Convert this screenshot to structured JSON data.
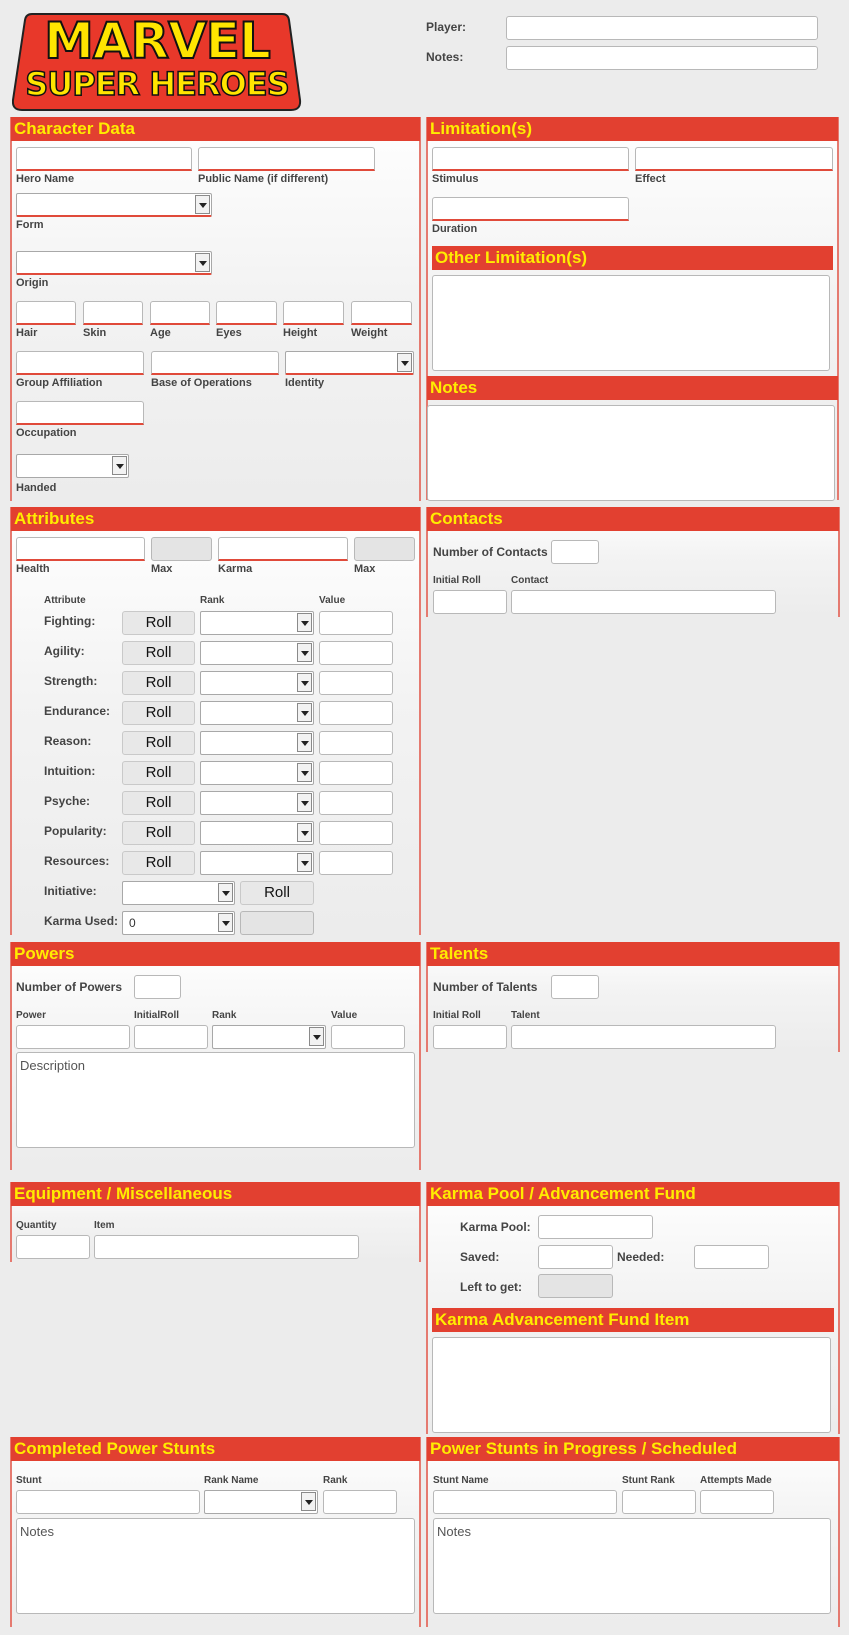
{
  "logo": {
    "line1": "MARVEL",
    "line2": "SUPER HEROES"
  },
  "header": {
    "player_label": "Player:",
    "notes_label": "Notes:"
  },
  "character_data": {
    "title": "Character Data",
    "hero_name": "Hero Name",
    "public_name": "Public Name (if different)",
    "form": "Form",
    "origin": "Origin",
    "hair": "Hair",
    "skin": "Skin",
    "age": "Age",
    "eyes": "Eyes",
    "height": "Height",
    "weight": "Weight",
    "group_affiliation": "Group Affiliation",
    "base_of_operations": "Base of Operations",
    "identity": "Identity",
    "occupation": "Occupation",
    "handed": "Handed"
  },
  "limitations": {
    "title": "Limitation(s)",
    "stimulus": "Stimulus",
    "effect": "Effect",
    "duration": "Duration",
    "other_title": "Other Limitation(s)"
  },
  "notes": {
    "title": "Notes"
  },
  "attributes": {
    "title": "Attributes",
    "health": "Health",
    "max": "Max",
    "karma": "Karma",
    "col_attribute": "Attribute",
    "col_rank": "Rank",
    "col_value": "Value",
    "roll_label": "Roll",
    "rows": [
      {
        "label": "Fighting:"
      },
      {
        "label": "Agility:"
      },
      {
        "label": "Strength:"
      },
      {
        "label": "Endurance:"
      },
      {
        "label": "Reason:"
      },
      {
        "label": "Intuition:"
      },
      {
        "label": "Psyche:"
      },
      {
        "label": "Popularity:"
      },
      {
        "label": "Resources:"
      }
    ],
    "initiative": "Initiative:",
    "karma_used": "Karma Used:",
    "karma_used_value": "0"
  },
  "contacts": {
    "title": "Contacts",
    "number_label": "Number of Contacts",
    "initial_roll": "Initial Roll",
    "contact": "Contact"
  },
  "powers": {
    "title": "Powers",
    "number_label": "Number of Powers",
    "power": "Power",
    "initial_roll": "InitialRoll",
    "rank": "Rank",
    "value": "Value",
    "description_placeholder": "Description"
  },
  "talents": {
    "title": "Talents",
    "number_label": "Number of Talents",
    "initial_roll": "Initial Roll",
    "talent": "Talent"
  },
  "equipment": {
    "title": "Equipment / Miscellaneous",
    "quantity": "Quantity",
    "item": "Item"
  },
  "karma_pool": {
    "title": "Karma Pool / Advancement Fund",
    "pool_label": "Karma Pool:",
    "saved_label": "Saved:",
    "needed_label": "Needed:",
    "left_label": "Left to get:",
    "fund_item_title": "Karma Advancement Fund Item"
  },
  "completed_stunts": {
    "title": "Completed Power Stunts",
    "stunt": "Stunt",
    "rank_name": "Rank Name",
    "rank": "Rank",
    "notes_placeholder": "Notes"
  },
  "stunts_progress": {
    "title": "Power Stunts in Progress / Scheduled",
    "stunt_name": "Stunt Name",
    "stunt_rank": "Stunt Rank",
    "attempts_made": "Attempts Made",
    "notes_placeholder": "Notes"
  }
}
